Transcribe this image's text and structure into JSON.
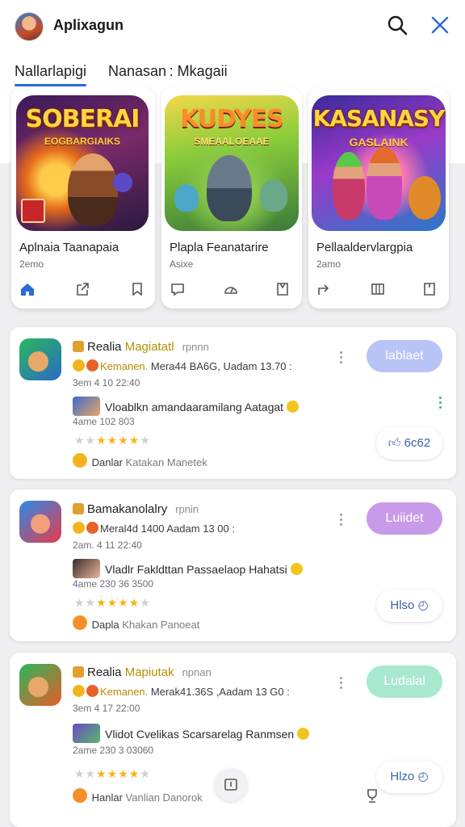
{
  "header": {
    "title": "Aplixagun",
    "search_icon": "search-icon",
    "close_icon": "close-icon"
  },
  "tabs": [
    {
      "label": "Nallarlapigi",
      "active": true
    },
    {
      "label": "Nanasan : Mkagaii",
      "active": false
    }
  ],
  "featured": [
    {
      "art_title": "SOBERAI",
      "art_sub": "EOGBARGIAIKS",
      "name": "Aplnaia Taanapaia",
      "sub": "2emo"
    },
    {
      "art_title": "KUDYES",
      "art_sub": "SMEAALOEAAE",
      "name": "Plapla Feanatarire",
      "sub": "Asixe"
    },
    {
      "art_title": "KASANASY",
      "art_sub": "GASLAINK",
      "name": "Pellaaldervlargpia",
      "sub": "2amo"
    }
  ],
  "results": [
    {
      "title_plain": "Realia",
      "title_hl": "Magiatatl",
      "title_muted": "rpnnn",
      "meta_prefix": "Kemanen.",
      "meta": "Mera44 BA6G, Uadam 13.70 :",
      "date": "3em  4 10 22:40",
      "review": "Vloablkn amandaaramilang Aatagat",
      "count": "4ame  102 803",
      "rating": 4,
      "dev_name": "Danlar",
      "dev_sub": "Katakan  Manetek",
      "action_label": "lablaet",
      "action_color": "#b7c4f5",
      "secondary_label": "6c62"
    },
    {
      "title_plain": "Bamakanolalry",
      "title_hl": "",
      "title_muted": "rpnin",
      "meta_prefix": "",
      "meta": "Meral4d 1400 Aadam 13 00 :",
      "date": "2am.  4 11 22:40",
      "review": "Vladlr Fakldttan Passaelaop Hahatsi",
      "count": "4ame  230  36 3500",
      "rating": 4,
      "dev_name": "Dapla",
      "dev_sub": "Khakan  Panoeat",
      "action_label": "Luiidet",
      "action_color": "#c89ae9",
      "secondary_label": "Hlso"
    },
    {
      "title_plain": "Realia",
      "title_hl": "Mapiutak",
      "title_muted": "npnan",
      "meta_prefix": "Kemanen.",
      "meta": "Merak41.36S ,Aadam 13 G0 :",
      "date": "3em  4 17 22:00",
      "review": "Vlidot Cvelikas Scarsarelag Ranmsen",
      "count": "2ame  230  3 03060",
      "rating": 4,
      "dev_name": "Hanlar",
      "dev_sub": "Vanlian  Danorok",
      "action_label": "Ludalal",
      "action_color": "#a8e8cf",
      "secondary_label": "Hlzo"
    }
  ],
  "colors": {
    "accent": "#2a6bd6",
    "star": "#f3b41b",
    "brand_blue": "#3d5fae"
  }
}
